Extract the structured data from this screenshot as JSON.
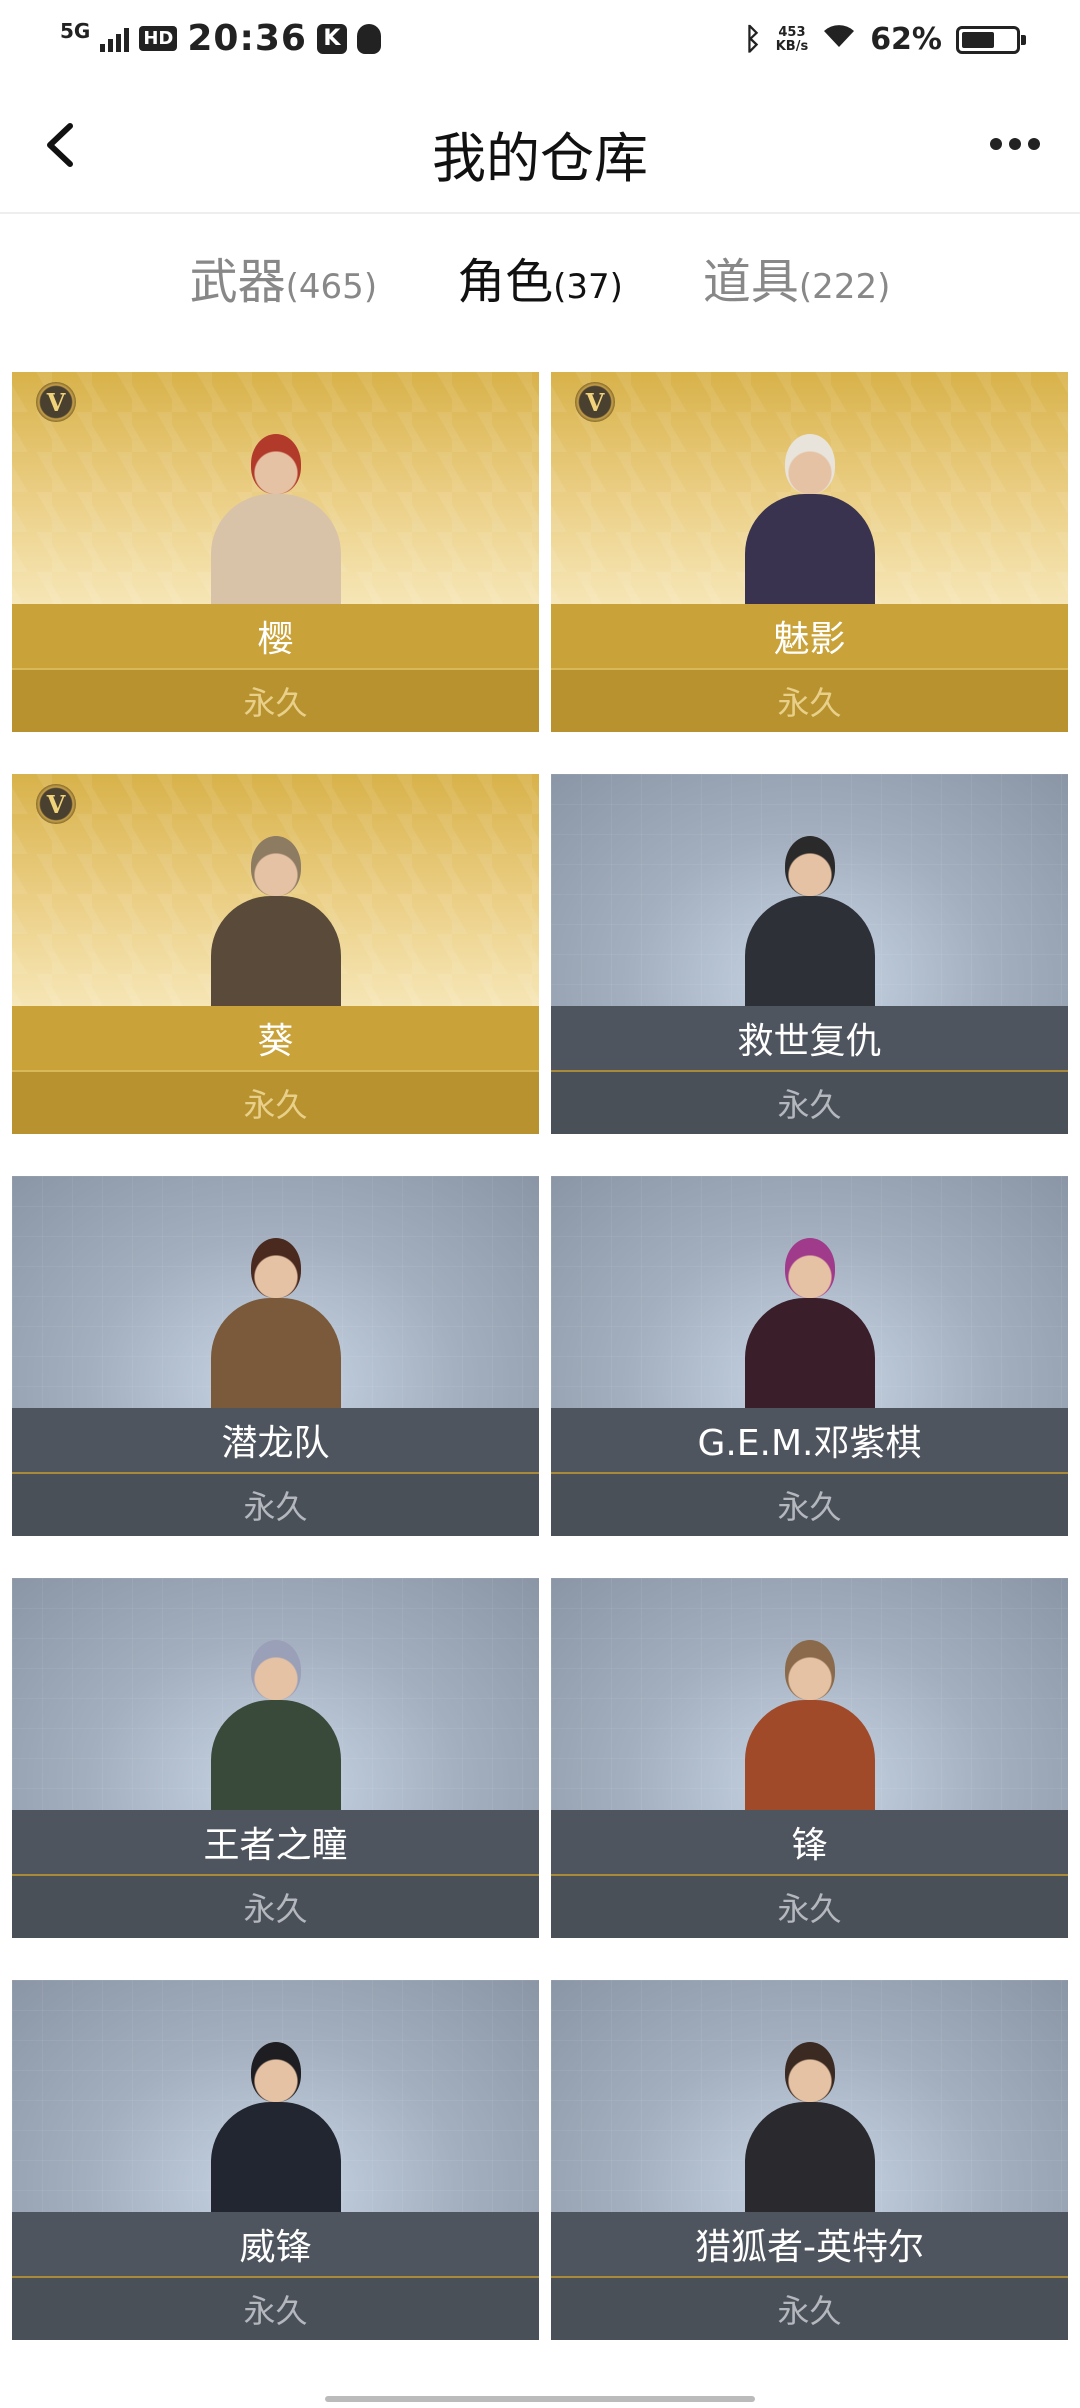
{
  "status_bar": {
    "network": "5G",
    "hd": "HD",
    "time": "20:36",
    "k_badge": "K",
    "speed_value": "453",
    "speed_unit": "KB/s",
    "battery_percent": "62%",
    "battery_level": 0.62
  },
  "header": {
    "title": "我的仓库"
  },
  "tabs": [
    {
      "label": "武器",
      "count": "(465)",
      "active": false
    },
    {
      "label": "角色",
      "count": "(37)",
      "active": true
    },
    {
      "label": "道具",
      "count": "(222)",
      "active": false
    }
  ],
  "colors": {
    "gold_name_bar": "#c9a23a",
    "gray_name_bar": "#4f555e"
  },
  "cards": [
    {
      "name": "樱",
      "duration": "永久",
      "tier": "gold",
      "vip": true,
      "v_badge": "V"
    },
    {
      "name": "魅影",
      "duration": "永久",
      "tier": "gold",
      "vip": true,
      "v_badge": "V"
    },
    {
      "name": "葵",
      "duration": "永久",
      "tier": "gold",
      "vip": true,
      "v_badge": "V"
    },
    {
      "name": "救世复仇",
      "duration": "永久",
      "tier": "gray",
      "vip": false
    },
    {
      "name": "潜龙队",
      "duration": "永久",
      "tier": "gray",
      "vip": false
    },
    {
      "name": "G.E.M.邓紫棋",
      "duration": "永久",
      "tier": "gray",
      "vip": false
    },
    {
      "name": "王者之瞳",
      "duration": "永久",
      "tier": "gray",
      "vip": false
    },
    {
      "name": "锋",
      "duration": "永久",
      "tier": "gray",
      "vip": false
    },
    {
      "name": "威锋",
      "duration": "永久",
      "tier": "gray",
      "vip": false
    },
    {
      "name": "猎狐者-英特尔",
      "duration": "永久",
      "tier": "gray",
      "vip": false
    }
  ]
}
